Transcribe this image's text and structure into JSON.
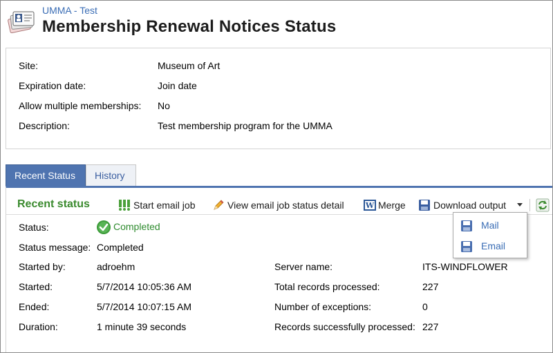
{
  "header": {
    "breadcrumb": "UMMA - Test",
    "title": "Membership Renewal Notices Status",
    "icon": "membership-cards-icon"
  },
  "details": [
    {
      "label": "Site:",
      "value": "Museum of Art"
    },
    {
      "label": "Expiration date:",
      "value": "Join date"
    },
    {
      "label": "Allow multiple memberships:",
      "value": "No"
    },
    {
      "label": "Description:",
      "value": "Test membership program for the UMMA"
    }
  ],
  "tabs": [
    {
      "label": "Recent Status",
      "active": true
    },
    {
      "label": "History",
      "active": false
    }
  ],
  "toolbar": {
    "section_title": "Recent status",
    "start_email_job": "Start email job",
    "view_email_job_status": "View email job status detail",
    "merge": "Merge",
    "download_output": "Download output",
    "icons": [
      "start-email-job-icon",
      "pencil-icon",
      "word-icon",
      "save-icon",
      "chevron-down-icon",
      "refresh-icon"
    ]
  },
  "status": {
    "status_label": "Status:",
    "status_value": "Completed",
    "message_label": "Status message:",
    "message_value": "Completed",
    "started_by_label": "Started by:",
    "started_by_value": "adroehm",
    "started_label": "Started:",
    "started_value": "5/7/2014 10:05:36 AM",
    "ended_label": "Ended:",
    "ended_value": "5/7/2014 10:07:15 AM",
    "duration_label": "Duration:",
    "duration_value": "1 minute 39 seconds",
    "server_name_label": "Server name:",
    "server_name_value": "ITS-WINDFLOWER",
    "total_records_label": "Total records processed:",
    "total_records_value": "227",
    "exceptions_label": "Number of exceptions:",
    "exceptions_value": "0",
    "success_label": "Records successfully processed:",
    "success_value": "227"
  },
  "download_menu": {
    "items": [
      "Mail",
      "Email"
    ]
  },
  "colors": {
    "accent": "#4f74b0",
    "link": "#3a6db5",
    "success": "#2e8b2e",
    "section_title": "#3a8a2e"
  }
}
